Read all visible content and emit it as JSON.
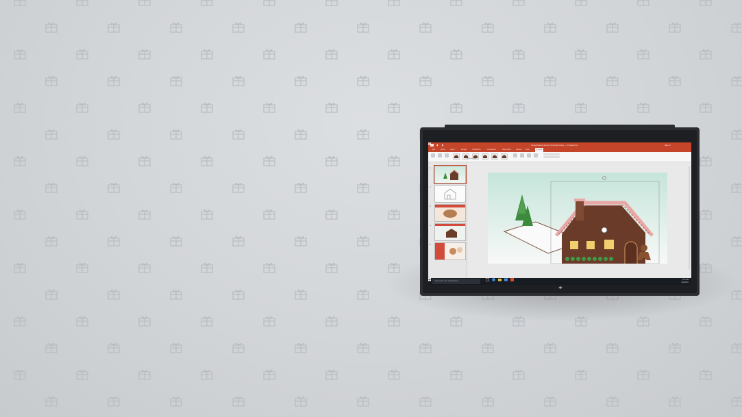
{
  "window": {
    "title": "Gingerbread House Christmas Party — PowerPoint",
    "user": "Sign in"
  },
  "ribbon": {
    "tabs": [
      {
        "label": "File"
      },
      {
        "label": "Home"
      },
      {
        "label": "Insert"
      },
      {
        "label": "Design"
      },
      {
        "label": "Transitions"
      },
      {
        "label": "Animations"
      },
      {
        "label": "Slide Show"
      },
      {
        "label": "Review"
      },
      {
        "label": "View"
      },
      {
        "label": "Format",
        "active": true
      }
    ],
    "group_label": "3D Model Views"
  },
  "slides": [
    {
      "number": "1"
    },
    {
      "number": "2"
    },
    {
      "number": "3"
    },
    {
      "number": "4"
    },
    {
      "number": "5"
    }
  ],
  "taskbar": {
    "search_placeholder": "Search the web and Windows",
    "time": "9:17 AM",
    "date": "12/3/2017"
  },
  "colors": {
    "accent": "#c4452a",
    "taskbar": "#171b22",
    "background": "#d2d5d8"
  }
}
